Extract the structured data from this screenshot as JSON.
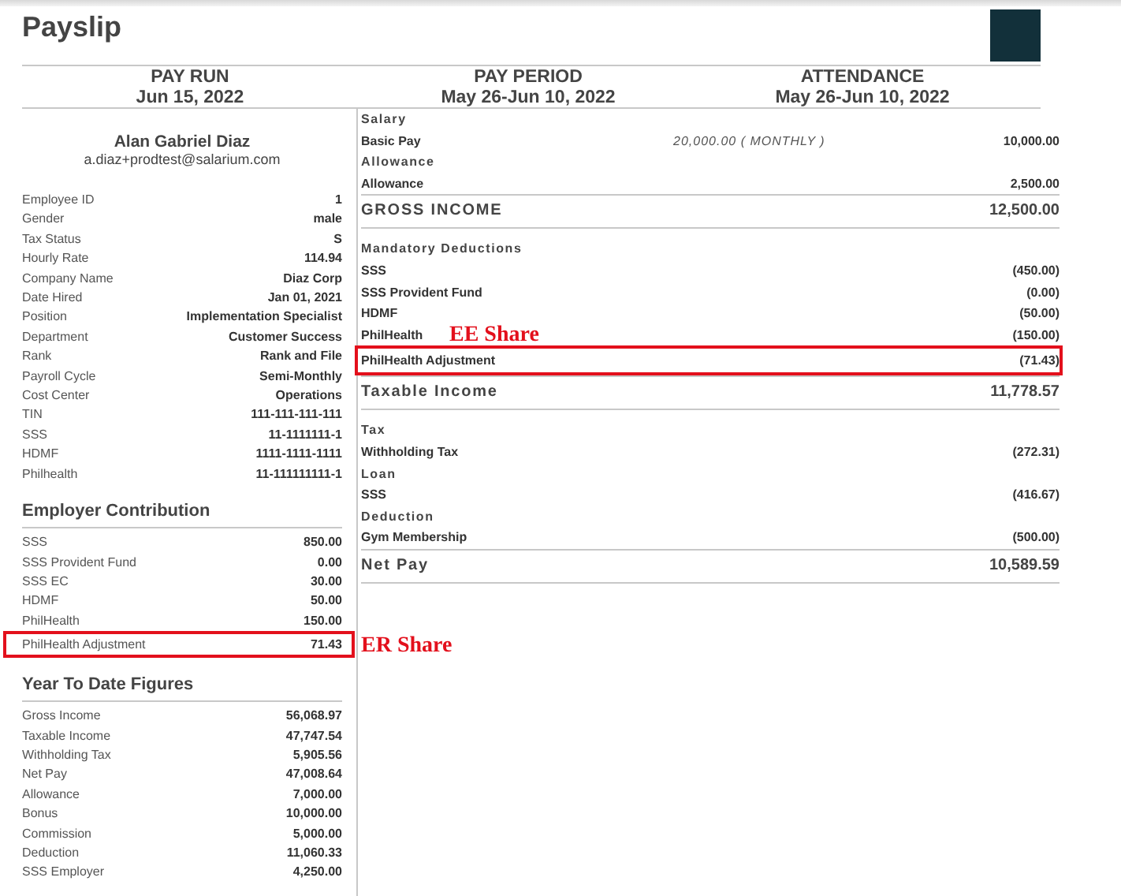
{
  "title": "Payslip",
  "header": [
    {
      "label": "PAY RUN",
      "value": "Jun 15, 2022"
    },
    {
      "label": "PAY PERIOD",
      "value": "May 26-Jun 10, 2022"
    },
    {
      "label": "ATTENDANCE",
      "value": "May 26-Jun 10, 2022"
    }
  ],
  "employee": {
    "name": "Alan Gabriel Diaz",
    "email": "a.diaz+prodtest@salarium.com"
  },
  "details": [
    {
      "label": "Employee ID",
      "value": "1"
    },
    {
      "label": "Gender",
      "value": "male"
    },
    {
      "label": "Tax Status",
      "value": "S"
    },
    {
      "label": "Hourly Rate",
      "value": "114.94"
    },
    {
      "label": "Company Name",
      "value": "Diaz Corp"
    },
    {
      "label": "Date Hired",
      "value": "Jan 01, 2021"
    },
    {
      "label": "Position",
      "value": "Implementation Specialist"
    },
    {
      "label": "Department",
      "value": "Customer Success"
    },
    {
      "label": "Rank",
      "value": "Rank and File"
    },
    {
      "label": "Payroll Cycle",
      "value": "Semi-Monthly"
    },
    {
      "label": "Cost Center",
      "value": "Operations"
    },
    {
      "label": "TIN",
      "value": "111-111-111-111"
    },
    {
      "label": "SSS",
      "value": "11-1111111-1"
    },
    {
      "label": "HDMF",
      "value": "1111-1111-1111"
    },
    {
      "label": "Philhealth",
      "value": "11-111111111-1"
    }
  ],
  "employer_contribution": {
    "title": "Employer Contribution",
    "rows": [
      {
        "label": "SSS",
        "value": "850.00"
      },
      {
        "label": "SSS Provident Fund",
        "value": "0.00"
      },
      {
        "label": "SSS EC",
        "value": "30.00"
      },
      {
        "label": "HDMF",
        "value": "50.00"
      },
      {
        "label": "PhilHealth",
        "value": "150.00"
      },
      {
        "label": "PhilHealth Adjustment",
        "value": "71.43",
        "annotation": "ER Share"
      }
    ]
  },
  "year_to_date": {
    "title": "Year To Date Figures",
    "rows": [
      {
        "label": "Gross Income",
        "value": "56,068.97"
      },
      {
        "label": "Taxable Income",
        "value": "47,747.54"
      },
      {
        "label": "Withholding Tax",
        "value": "5,905.56"
      },
      {
        "label": "Net Pay",
        "value": "47,008.64"
      },
      {
        "label": "Allowance",
        "value": "7,000.00"
      },
      {
        "label": "Bonus",
        "value": "10,000.00"
      },
      {
        "label": "Commission",
        "value": "5,000.00"
      },
      {
        "label": "Deduction",
        "value": "11,060.33"
      },
      {
        "label": "SSS Employer",
        "value": "4,250.00"
      }
    ]
  },
  "computation": [
    {
      "kind": "group",
      "label": "Salary"
    },
    {
      "kind": "item",
      "label": "Basic Pay",
      "note": "20,000.00 ( MONTHLY )",
      "value": "10,000.00"
    },
    {
      "kind": "group",
      "label": "Allowance"
    },
    {
      "kind": "item",
      "label": "Allowance",
      "value": "2,500.00"
    },
    {
      "kind": "total",
      "label": "GROSS INCOME",
      "value": "12,500.00"
    },
    {
      "kind": "group",
      "label": "Mandatory Deductions"
    },
    {
      "kind": "item",
      "label": "SSS",
      "value": "(450.00)"
    },
    {
      "kind": "item",
      "label": "SSS Provident Fund",
      "value": "(0.00)"
    },
    {
      "kind": "item",
      "label": "HDMF",
      "value": "(50.00)"
    },
    {
      "kind": "item",
      "label": "PhilHealth",
      "value": "(150.00)"
    },
    {
      "kind": "item",
      "label": "PhilHealth Adjustment",
      "value": "(71.43)",
      "annotation": "EE Share"
    },
    {
      "kind": "total",
      "label": "Taxable Income",
      "value": "11,778.57"
    },
    {
      "kind": "group",
      "label": "Tax"
    },
    {
      "kind": "item",
      "label": "Withholding Tax",
      "value": "(272.31)"
    },
    {
      "kind": "group",
      "label": "Loan"
    },
    {
      "kind": "item",
      "label": "SSS",
      "value": "(416.67)"
    },
    {
      "kind": "group",
      "label": "Deduction"
    },
    {
      "kind": "item",
      "label": "Gym Membership",
      "value": "(500.00)"
    },
    {
      "kind": "total",
      "label": "Net Pay",
      "value": "10,589.59"
    }
  ]
}
